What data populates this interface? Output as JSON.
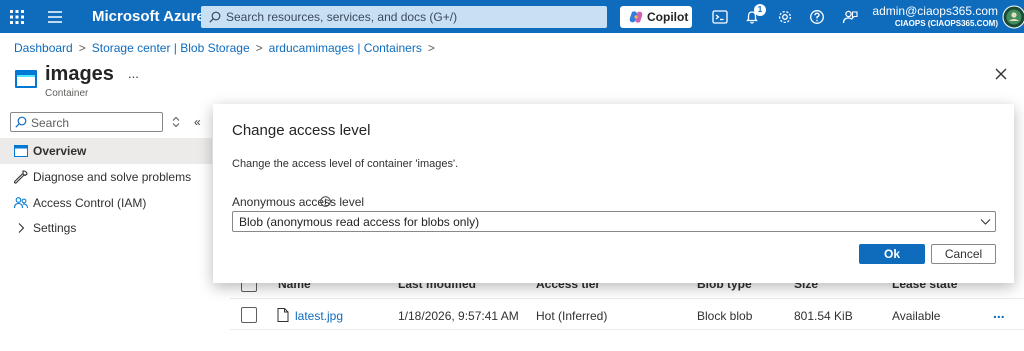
{
  "topbar": {
    "brand": "Microsoft Azure",
    "search_placeholder": "Search resources, services, and docs (G+/)",
    "copilot_label": "Copilot",
    "notification_count": "1",
    "user_email": "admin@ciaops365.com",
    "user_tenant": "CIAOPS (CIAOPS365.COM)",
    "accent_color": "#0f6cbd"
  },
  "breadcrumb": {
    "items": [
      "Dashboard",
      "Storage center | Blob Storage",
      "arducamimages | Containers"
    ]
  },
  "header": {
    "title": "images",
    "more": "...",
    "subtitle": "Container"
  },
  "sidebar": {
    "search_placeholder": "Search",
    "collapse": "«",
    "items": [
      {
        "label": "Overview",
        "icon": "overview-icon"
      },
      {
        "label": "Diagnose and solve problems",
        "icon": "wrench-icon"
      },
      {
        "label": "Access Control (IAM)",
        "icon": "people-icon"
      },
      {
        "label": "Settings",
        "icon": "chevron-right-icon"
      }
    ]
  },
  "table": {
    "headers": [
      "Name",
      "Last modified",
      "Access tier",
      "Blob type",
      "Size",
      "Lease state"
    ],
    "rows": [
      {
        "name": "latest.jpg",
        "modified": "1/18/2026, 9:57:41 AM",
        "tier": "Hot (Inferred)",
        "blob_type": "Block blob",
        "size": "801.54 KiB",
        "lease": "Available",
        "more": "..."
      }
    ]
  },
  "dialog": {
    "title": "Change access level",
    "description": "Change the access level of container 'images'.",
    "field_label": "Anonymous access level",
    "selected_value": "Blob (anonymous read access for blobs only)",
    "ok_label": "Ok",
    "cancel_label": "Cancel"
  }
}
